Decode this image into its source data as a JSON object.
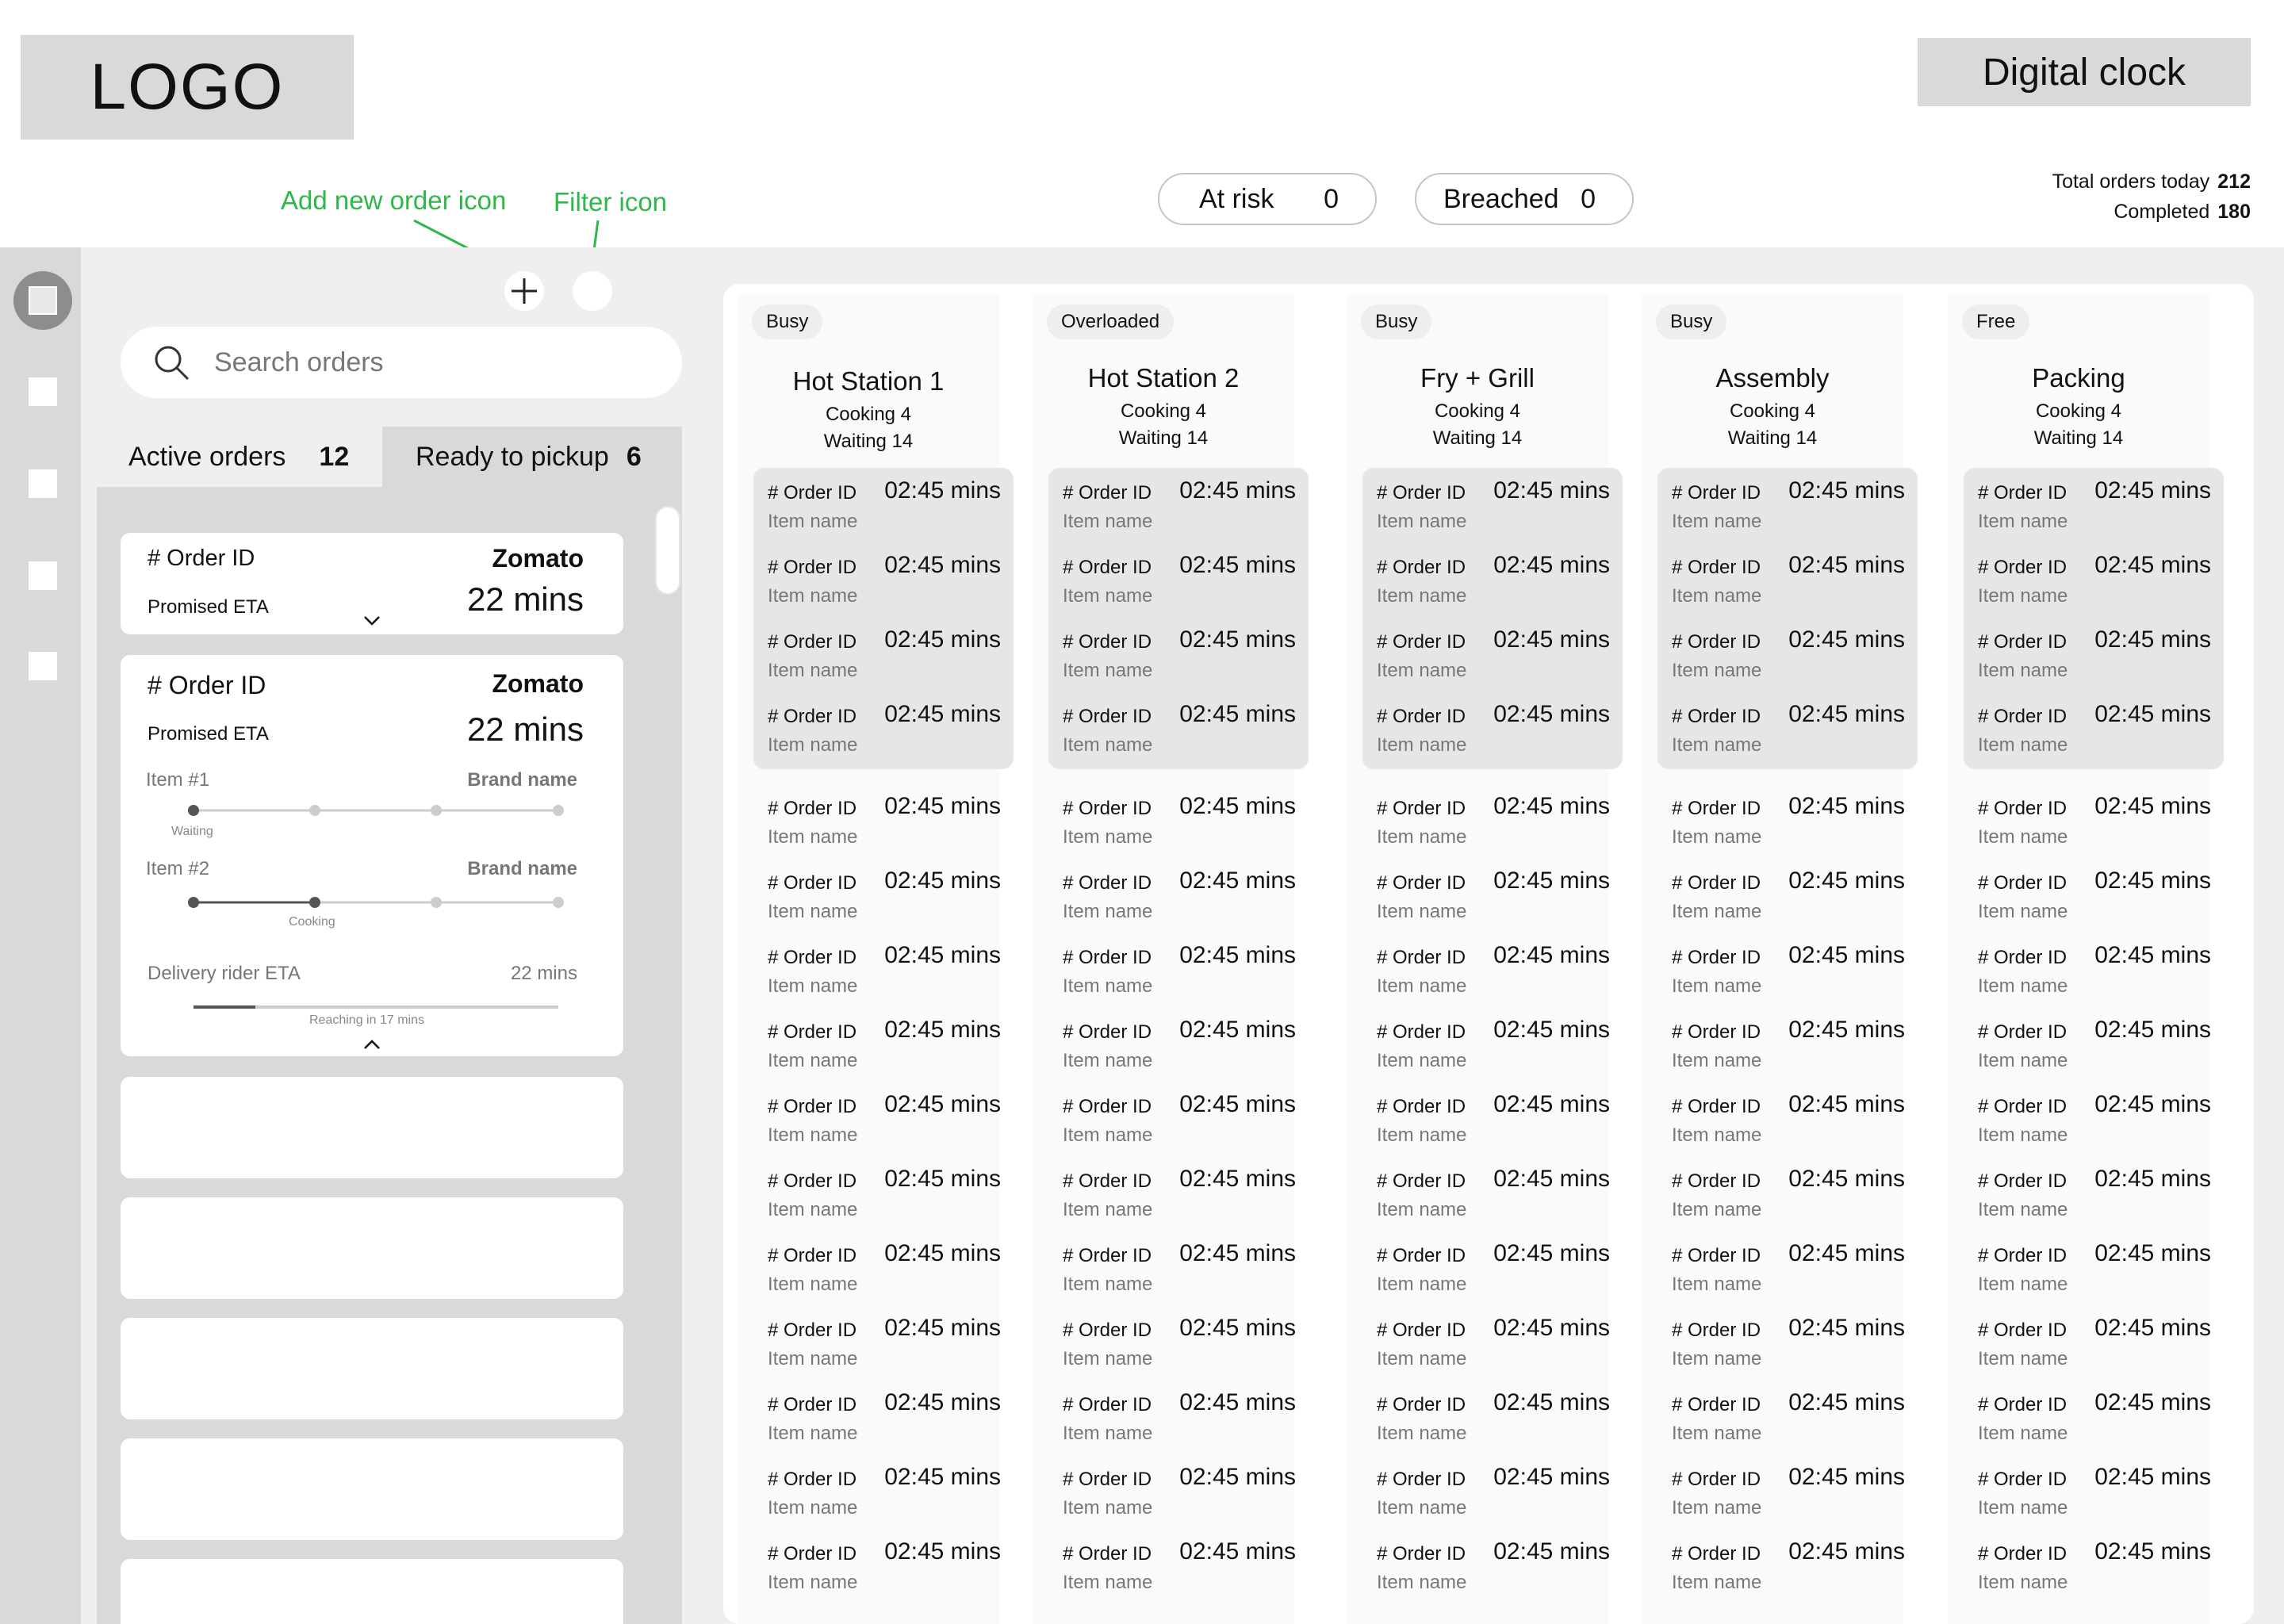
{
  "header": {
    "logo": "LOGO",
    "clock": "Digital clock",
    "annotations": {
      "add_icon": "Add new order icon",
      "filter_icon": "Filter icon"
    },
    "at_risk": {
      "label": "At risk",
      "count": "0"
    },
    "breached": {
      "label": "Breached",
      "count": "0"
    },
    "totals": {
      "total_label": "Total orders today",
      "total_value": "212",
      "completed_label": "Completed",
      "completed_value": "180"
    }
  },
  "sidebar": {
    "items": [
      "home-icon",
      "nav-square-icon",
      "nav-square-icon",
      "nav-square-icon",
      "nav-square-icon"
    ]
  },
  "toolbar": {
    "plus": "+"
  },
  "search": {
    "placeholder": "Search orders"
  },
  "tabs": [
    {
      "label": "Active orders",
      "count": "12"
    },
    {
      "label": "Ready to pickup",
      "count": "6"
    }
  ],
  "orders": {
    "collapsed": {
      "order_id": "# Order ID",
      "brand": "Zomato",
      "eta_label": "Promised ETA",
      "eta_value": "22 mins",
      "expand": "⌄"
    },
    "expanded": {
      "order_id": "# Order ID",
      "brand": "Zomato",
      "eta_label": "Promised ETA",
      "eta_value": "22 mins",
      "items": [
        {
          "name": "Item #1",
          "brand": "Brand name",
          "stage": "Waiting",
          "progress_stage_index": 0
        },
        {
          "name": "Item #2",
          "brand": "Brand name",
          "stage": "Cooking",
          "progress_stage_index": 1
        }
      ],
      "rider_label": "Delivery rider ETA",
      "rider_value": "22 mins",
      "rider_progress": 0.17,
      "rider_note": "Reaching in 17 mins",
      "collapse": "^"
    }
  },
  "stations": [
    {
      "status": "Busy",
      "name": "Hot Station 1",
      "cooking": "Cooking 4",
      "waiting": "Waiting 14"
    },
    {
      "status": "Overloaded",
      "name": "Hot Station 2",
      "cooking": "Cooking 4",
      "waiting": "Waiting 14"
    },
    {
      "status": "Busy",
      "name": "Fry + Grill",
      "cooking": "Cooking 4",
      "waiting": "Waiting 14"
    },
    {
      "status": "Busy",
      "name": "Assembly",
      "cooking": "Cooking 4",
      "waiting": "Waiting 14"
    },
    {
      "status": "Free",
      "name": "Packing",
      "cooking": "Cooking 4",
      "waiting": "Waiting 14"
    }
  ],
  "station_order": {
    "order_id": "# Order ID",
    "time": "02:45 mins",
    "item": "Item name"
  },
  "station_orders_count": 15,
  "station_cooking_count": 4
}
